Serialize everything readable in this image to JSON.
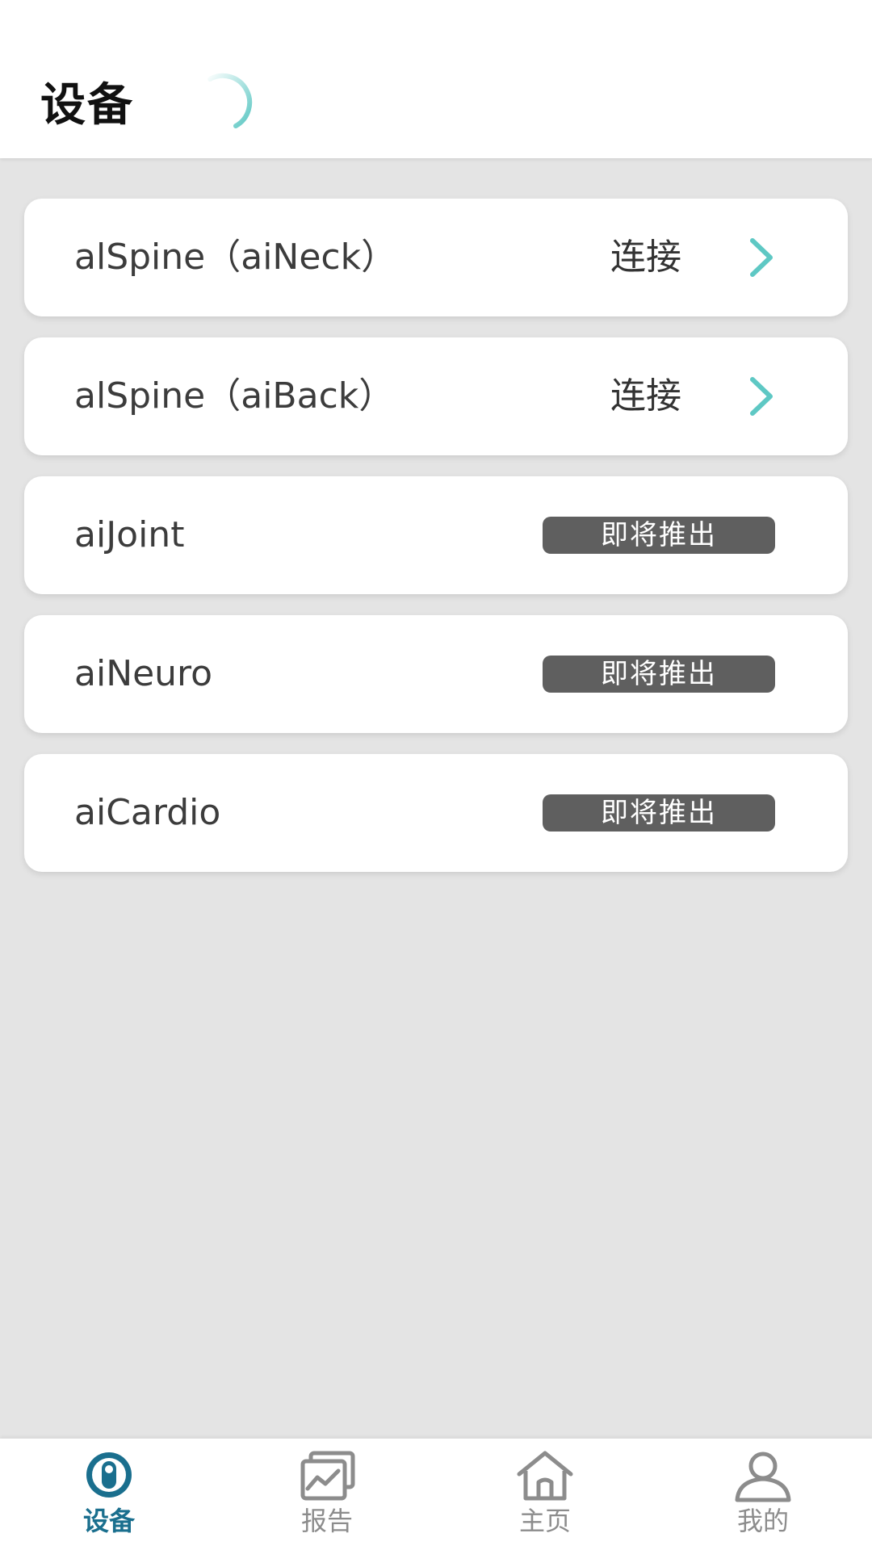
{
  "header": {
    "title": "设备"
  },
  "devices": [
    {
      "name": "alSpine（aiNeck）",
      "action_label": "连接"
    },
    {
      "name": "alSpine（aiBack）",
      "action_label": "连接"
    },
    {
      "name": "aiJoint",
      "badge": "即将推出"
    },
    {
      "name": "aiNeuro",
      "badge": "即将推出"
    },
    {
      "name": "aiCardio",
      "badge": "即将推出"
    }
  ],
  "nav": {
    "items": [
      {
        "label": "设备",
        "icon": "device-icon",
        "active": true
      },
      {
        "label": "报告",
        "icon": "report-icon",
        "active": false
      },
      {
        "label": "主页",
        "icon": "home-icon",
        "active": false
      },
      {
        "label": "我的",
        "icon": "profile-icon",
        "active": false
      }
    ]
  },
  "colors": {
    "accent": "#5ec8c4",
    "nav_active": "#1a6f8e",
    "badge_bg": "#5f5f5f",
    "background": "#e4e4e4"
  }
}
